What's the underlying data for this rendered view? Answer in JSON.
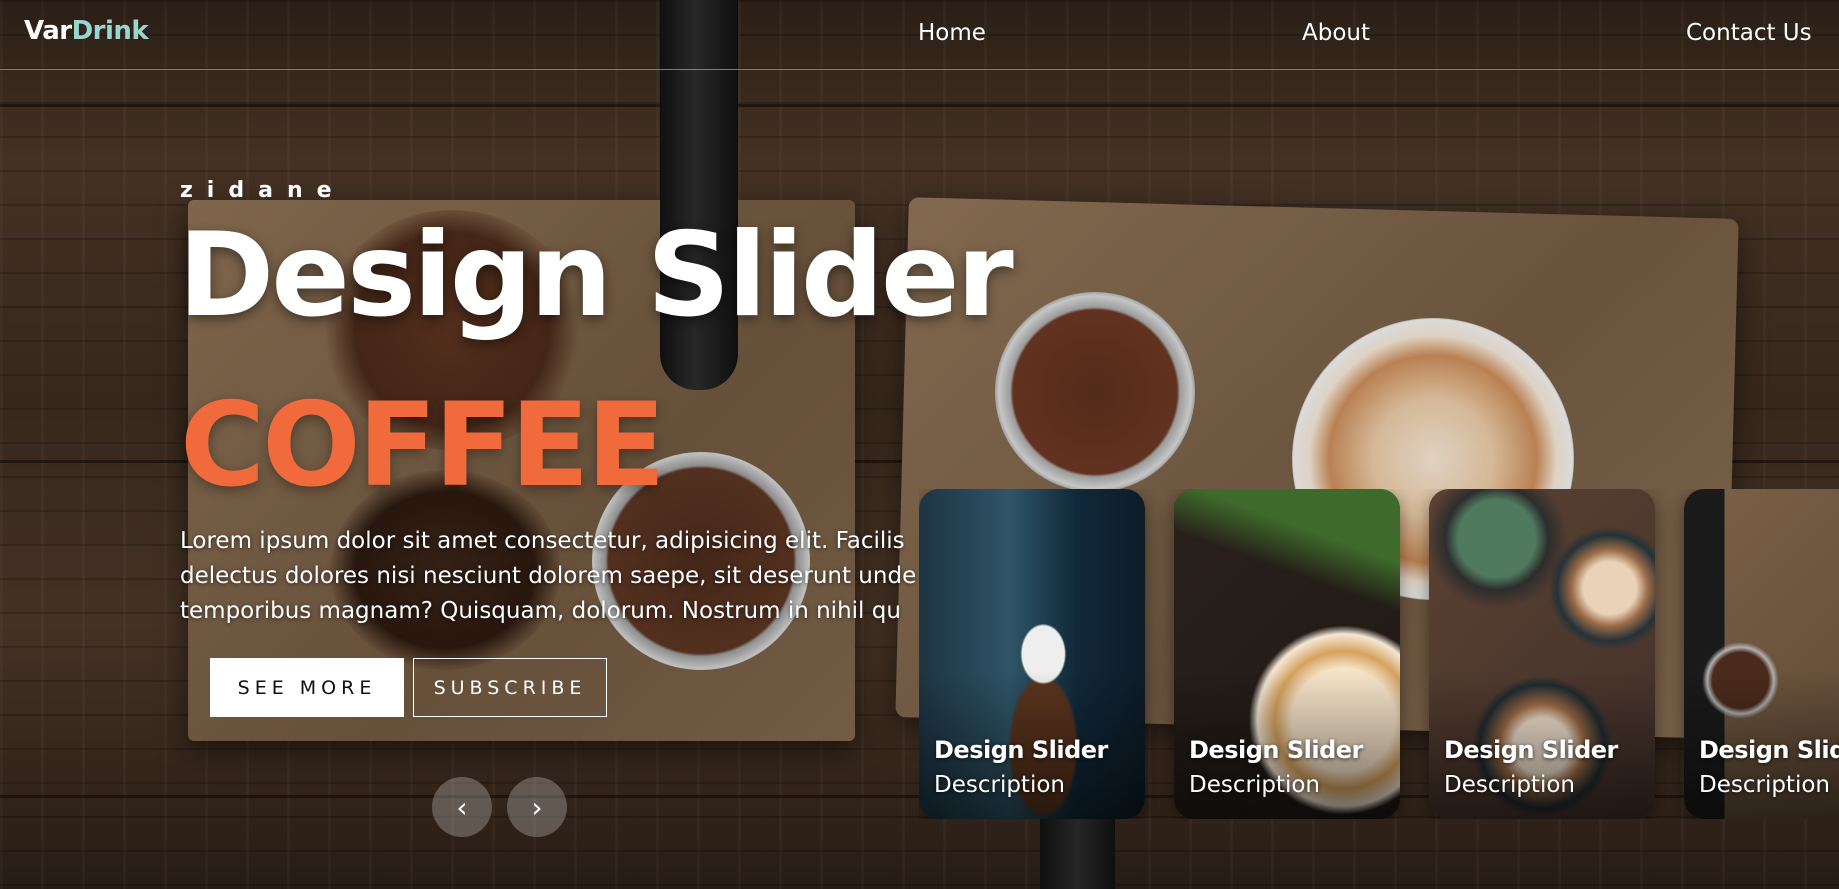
{
  "brand": {
    "name_primary": "Var",
    "name_accent": "Drink"
  },
  "nav": {
    "items": [
      "Home",
      "About",
      "Contact Us"
    ]
  },
  "hero": {
    "eyebrow": "zidane",
    "title": "Design Slider",
    "topic": "COFFEE",
    "description": "Lorem ipsum dolor sit amet consectetur, adipisicing elit. Facilis delectus dolores nisi nesciunt dolorem saepe, sit deserunt unde temporibus magnam? Quisquam, dolorum. Nostrum in nihil qu",
    "buttons": {
      "see_more": "SEE MORE",
      "subscribe": "SUBSCRIBE"
    },
    "arrows": {
      "prev": "‹",
      "next": "›"
    }
  },
  "thumbnails": [
    {
      "title": "Design Slider",
      "description": "Description"
    },
    {
      "title": "Design Slider",
      "description": "Description"
    },
    {
      "title": "Design Slider",
      "description": "Description"
    },
    {
      "title": "Design Slider",
      "description": "Description"
    }
  ],
  "colors": {
    "accent_logo": "#98d6cf",
    "accent_topic": "#f06a3b"
  }
}
